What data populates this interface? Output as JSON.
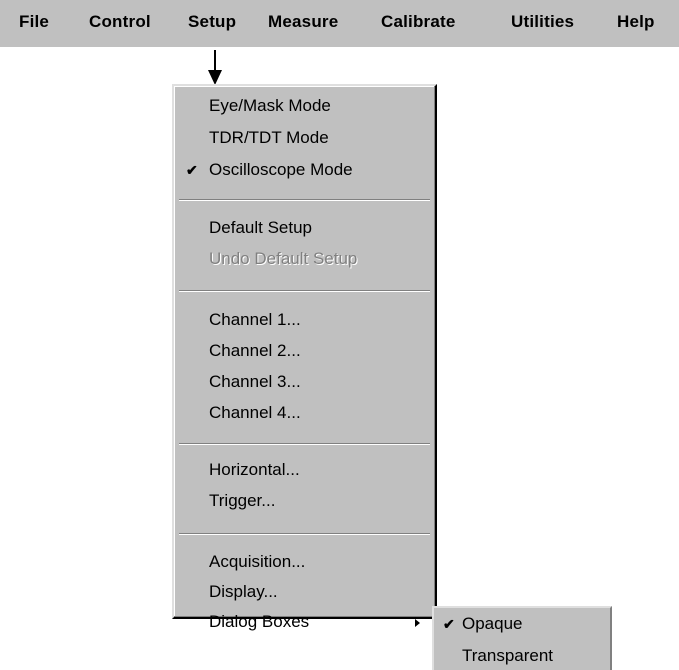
{
  "menubar": {
    "items": [
      {
        "label": "File"
      },
      {
        "label": "Control"
      },
      {
        "label": "Setup"
      },
      {
        "label": "Measure"
      },
      {
        "label": "Calibrate"
      },
      {
        "label": "Utilities"
      },
      {
        "label": "Help"
      }
    ]
  },
  "setup_menu": {
    "groups": [
      [
        {
          "label": "Eye/Mask Mode",
          "checked": false,
          "enabled": true
        },
        {
          "label": "TDR/TDT Mode",
          "checked": false,
          "enabled": true
        },
        {
          "label": "Oscilloscope Mode",
          "checked": true,
          "enabled": true
        }
      ],
      [
        {
          "label": "Default Setup",
          "checked": false,
          "enabled": true
        },
        {
          "label": "Undo Default Setup",
          "checked": false,
          "enabled": false
        }
      ],
      [
        {
          "label": "Channel 1...",
          "checked": false,
          "enabled": true
        },
        {
          "label": "Channel 2...",
          "checked": false,
          "enabled": true
        },
        {
          "label": "Channel 3...",
          "checked": false,
          "enabled": true
        },
        {
          "label": "Channel 4...",
          "checked": false,
          "enabled": true
        }
      ],
      [
        {
          "label": "Horizontal...",
          "checked": false,
          "enabled": true
        },
        {
          "label": "Trigger...",
          "checked": false,
          "enabled": true
        }
      ],
      [
        {
          "label": "Acquisition...",
          "checked": false,
          "enabled": true
        },
        {
          "label": "Display...",
          "checked": false,
          "enabled": true
        },
        {
          "label": "Dialog Boxes",
          "checked": false,
          "enabled": true,
          "submenu": true
        }
      ]
    ]
  },
  "dialog_boxes_submenu": {
    "items": [
      {
        "label": "Opaque",
        "checked": true
      },
      {
        "label": "Transparent",
        "checked": false
      }
    ]
  },
  "icons": {
    "pointer": "down-arrow-icon",
    "check": "checkmark-icon",
    "submenu": "submenu-arrow-icon"
  }
}
